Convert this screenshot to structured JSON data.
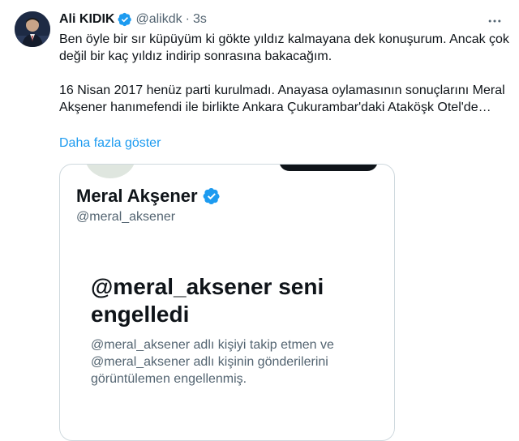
{
  "tweet": {
    "author_name": "Ali KIDIK",
    "author_handle": "@alikdk",
    "separator": "·",
    "time": "3s",
    "paragraph1": "Ben öyle bir sır küpüyüm ki gökte yıldız kalmayana dek konuşurum. Ancak çok değil bir kaç yıldız indirip sonrasına bakacağım.",
    "paragraph2": "16 Nisan 2017 henüz parti kurulmadı. Anayasa oylamasının sonuçlarını Meral Akşener hanımefendi ile birlikte Ankara Çukurambar'daki Ataköşk Otel'de…",
    "show_more": "Daha fazla göster"
  },
  "quoted_card": {
    "profile_name": "Meral Akşener",
    "profile_handle": "@meral_aksener",
    "blocked_title": "@meral_aksener seni engelledi",
    "blocked_description": "@meral_aksener adlı kişiyi takip etmen ve @meral_aksener adlı kişinin gönderilerini görüntülemen engellenmiş."
  },
  "icons": {
    "verified": "verified-badge-icon",
    "more": "more-options-icon"
  },
  "colors": {
    "accent": "#1d9bf0",
    "text_primary": "#0f1419",
    "text_secondary": "#536471",
    "border": "#cfd9de"
  }
}
